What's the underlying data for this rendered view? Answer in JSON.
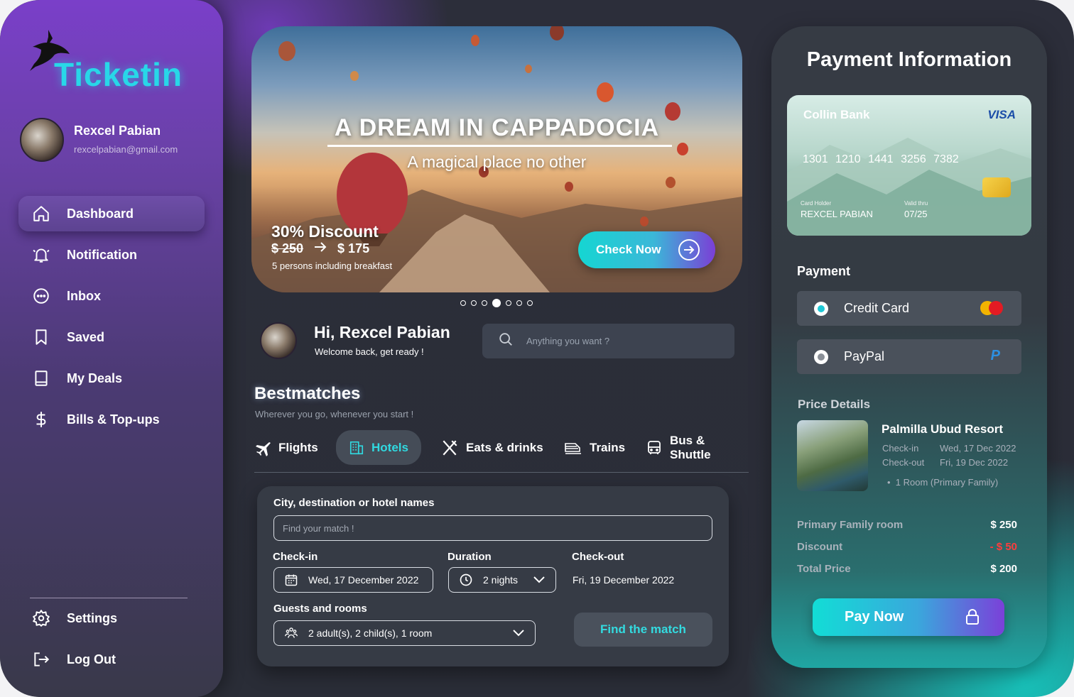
{
  "app": {
    "name": "Ticketin"
  },
  "user": {
    "name": "Rexcel Pabian",
    "email": "rexcelpabian@gmail.com"
  },
  "nav": {
    "items": [
      {
        "label": "Dashboard",
        "icon": "home-icon"
      },
      {
        "label": "Notification",
        "icon": "bell-icon"
      },
      {
        "label": "Inbox",
        "icon": "chat-icon"
      },
      {
        "label": "Saved",
        "icon": "bookmark-icon"
      },
      {
        "label": "My Deals",
        "icon": "book-icon"
      },
      {
        "label": "Bills & Top-ups",
        "icon": "dollar-icon"
      }
    ],
    "settings_label": "Settings",
    "logout_label": "Log Out"
  },
  "hero": {
    "title": "A DREAM IN CAPPADOCIA",
    "subtitle": "A magical place no other",
    "discount": "30% Discount",
    "old_price": "$ 250",
    "new_price": "$ 175",
    "note": "5 persons including breakfast",
    "cta": "Check Now",
    "slides_total": 7,
    "slide_active": 4
  },
  "greeting": {
    "title": "Hi, Rexcel Pabian",
    "subtitle": "Welcome back, get ready !"
  },
  "search": {
    "placeholder": "Anything you want ?"
  },
  "bestmatches": {
    "title": "Bestmatches",
    "subtitle": "Wherever you go, whenever you start !",
    "tabs": [
      {
        "label": "Flights",
        "icon": "plane-icon"
      },
      {
        "label": "Hotels",
        "icon": "hotel-icon",
        "active": true
      },
      {
        "label": "Eats & drinks",
        "icon": "utensils-icon"
      },
      {
        "label": "Trains",
        "icon": "train-icon"
      },
      {
        "label": "Bus & Shuttle",
        "icon": "bus-icon"
      }
    ]
  },
  "form": {
    "destination_label": "City, destination or hotel names",
    "destination_placeholder": "Find your match !",
    "checkin_label": "Check-in",
    "checkin_value": "Wed, 17 December 2022",
    "duration_label": "Duration",
    "duration_value": "2 nights",
    "checkout_label": "Check-out",
    "checkout_value": "Fri, 19 December 2022",
    "guests_label": "Guests and rooms",
    "guests_value": "2 adult(s), 2 child(s), 1 room",
    "submit_label": "Find the match"
  },
  "payment": {
    "title": "Payment Information",
    "card": {
      "bank": "Collin Bank",
      "network": "VISA",
      "number": "1301 1210 1441 3256 7382",
      "holder_label": "Card Holder",
      "holder": "REXCEL PABIAN",
      "valid_label": "Valid thru",
      "valid": "07/25"
    },
    "section_label": "Payment",
    "methods": [
      {
        "label": "Credit Card",
        "selected": true,
        "icon": "mastercard-icon"
      },
      {
        "label": "PayPal",
        "selected": false,
        "icon": "paypal-icon"
      }
    ],
    "price_details_label": "Price Details",
    "resort": {
      "name": "Palmilla Ubud Resort",
      "checkin_label": "Check-in",
      "checkin": "Wed, 17 Dec 2022",
      "checkout_label": "Check-out",
      "checkout": "Fri, 19 Dec 2022",
      "room": "1 Room (Primary Family)"
    },
    "lines": [
      {
        "label": "Primary Family room",
        "amount": "$ 250"
      },
      {
        "label": "Discount",
        "amount": "- $ 50"
      },
      {
        "label": "Total Price",
        "amount": "$ 200"
      }
    ],
    "pay_label": "Pay Now"
  },
  "colors": {
    "accent_teal": "#1fd6d6",
    "accent_purple": "#7b3fd6",
    "discount_red": "#ff3d3d"
  }
}
